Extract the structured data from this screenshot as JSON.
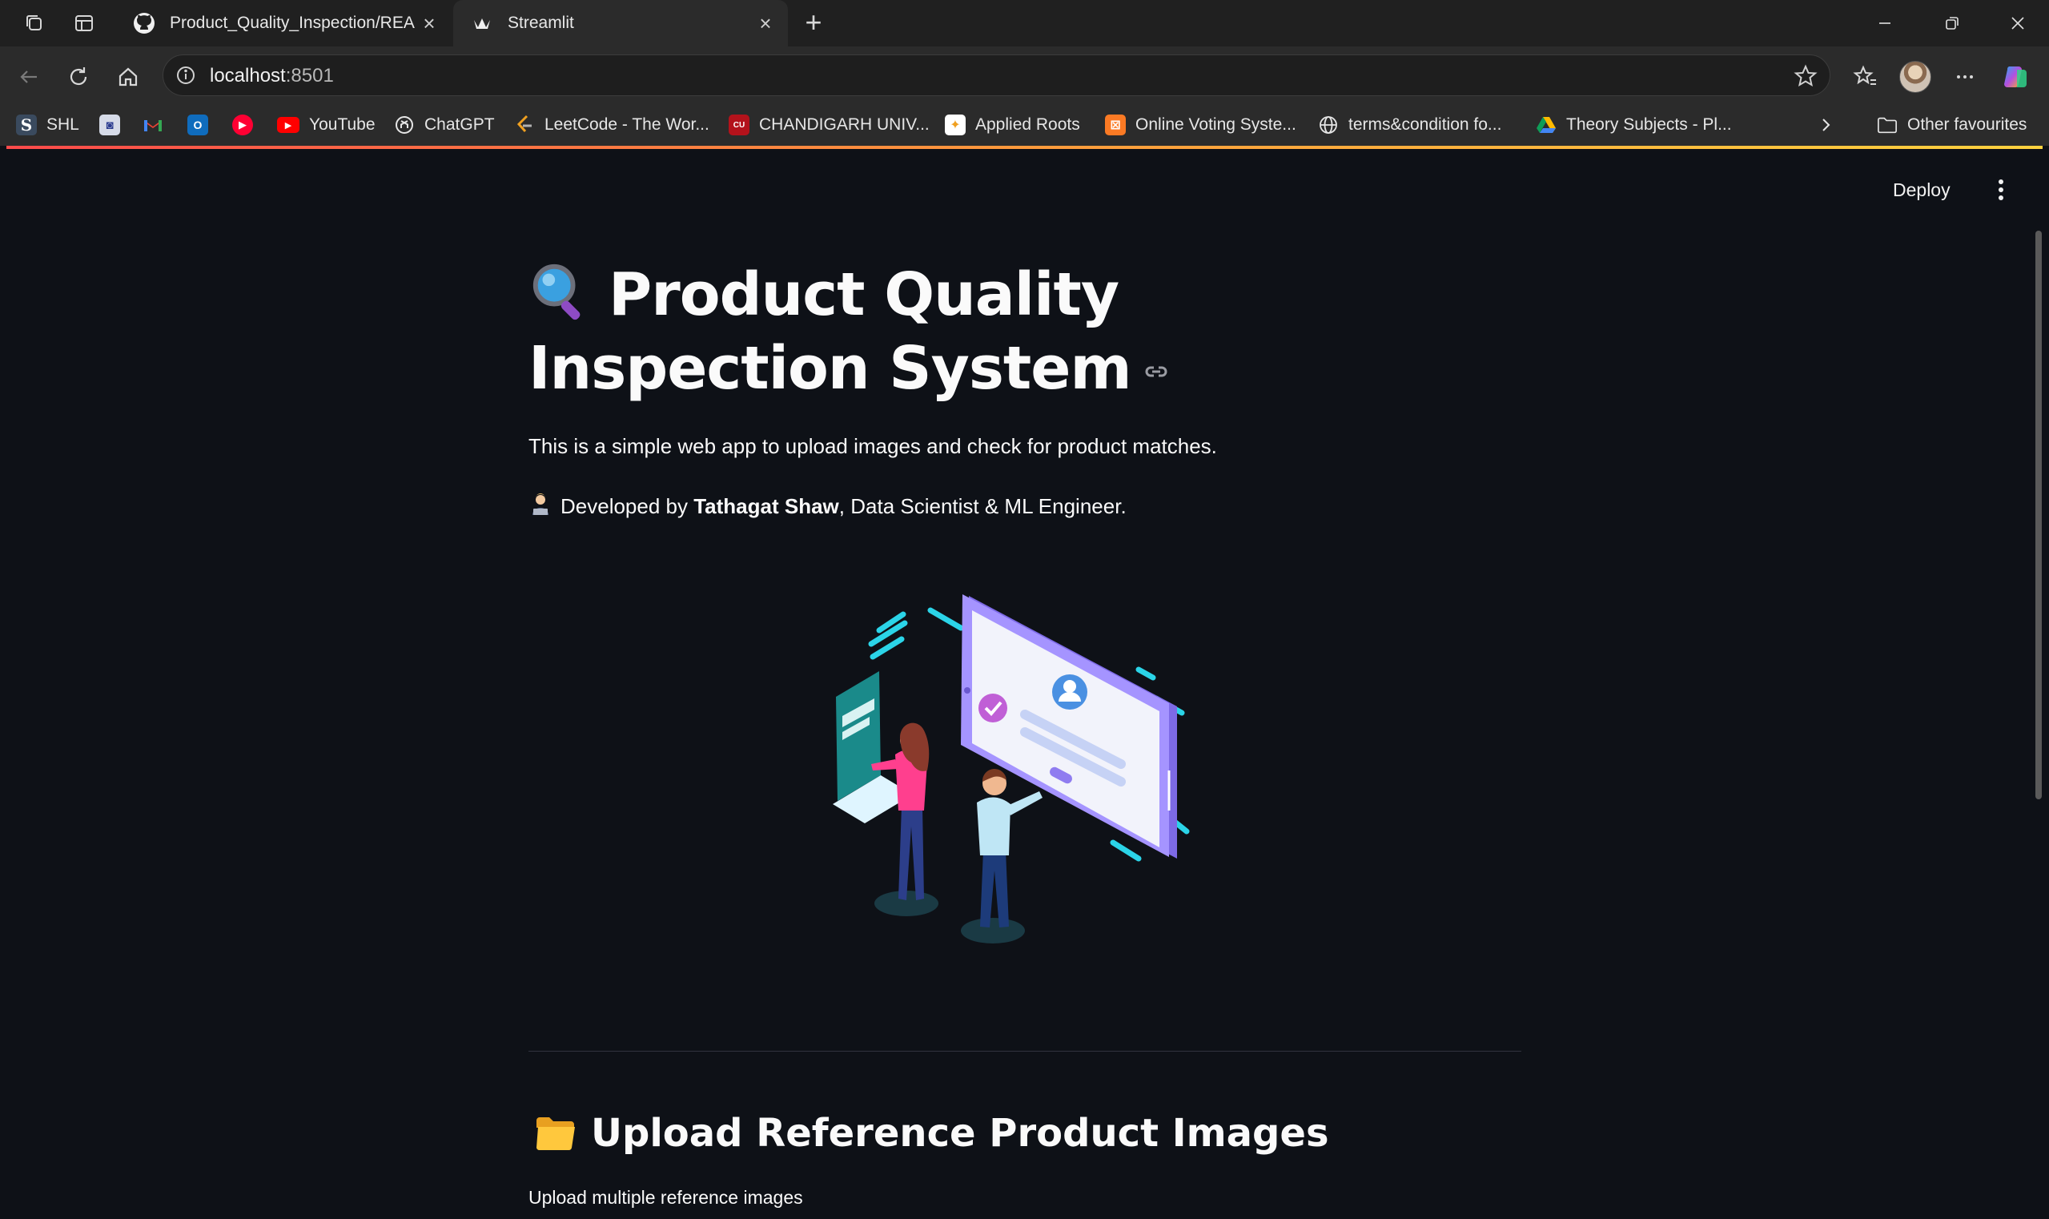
{
  "browser": {
    "tabs": [
      {
        "title": "Product_Quality_Inspection/READ",
        "active": false
      },
      {
        "title": "Streamlit",
        "active": true
      }
    ],
    "url_host": "localhost",
    "url_port": ":8501",
    "bookmarks": [
      {
        "label": "SHL",
        "icon": "shl-icon"
      },
      {
        "label": "",
        "icon": "bookmark-app-icon"
      },
      {
        "label": "",
        "icon": "gmail-icon"
      },
      {
        "label": "",
        "icon": "outlook-icon"
      },
      {
        "label": "",
        "icon": "youtube-music-icon"
      },
      {
        "label": "YouTube",
        "icon": "youtube-icon"
      },
      {
        "label": "ChatGPT",
        "icon": "chatgpt-icon"
      },
      {
        "label": "LeetCode - The Wor...",
        "icon": "leetcode-icon"
      },
      {
        "label": "CHANDIGARH UNIV...",
        "icon": "cu-icon"
      },
      {
        "label": "Applied Roots",
        "icon": "applied-roots-icon"
      },
      {
        "label": "Online Voting Syste...",
        "icon": "xampp-icon"
      },
      {
        "label": "terms&condition fo...",
        "icon": "globe-icon"
      },
      {
        "label": "Theory Subjects - Pl...",
        "icon": "google-drive-icon"
      }
    ],
    "other_favourites": "Other favourites"
  },
  "app": {
    "deploy_label": "Deploy",
    "title": "Product Quality Inspection System",
    "description": "This is a simple web app to upload images and check for product matches.",
    "developed_prefix": "Developed by ",
    "developer_name": "Tathagat Shaw",
    "developed_suffix": ", Data Scientist & ML Engineer.",
    "upload_header": "Upload Reference Product Images",
    "upload_label": "Upload multiple reference images"
  },
  "colors": {
    "page_bg": "#0e1117",
    "accent_red": "#ff4b4b",
    "text": "#fafafa"
  }
}
